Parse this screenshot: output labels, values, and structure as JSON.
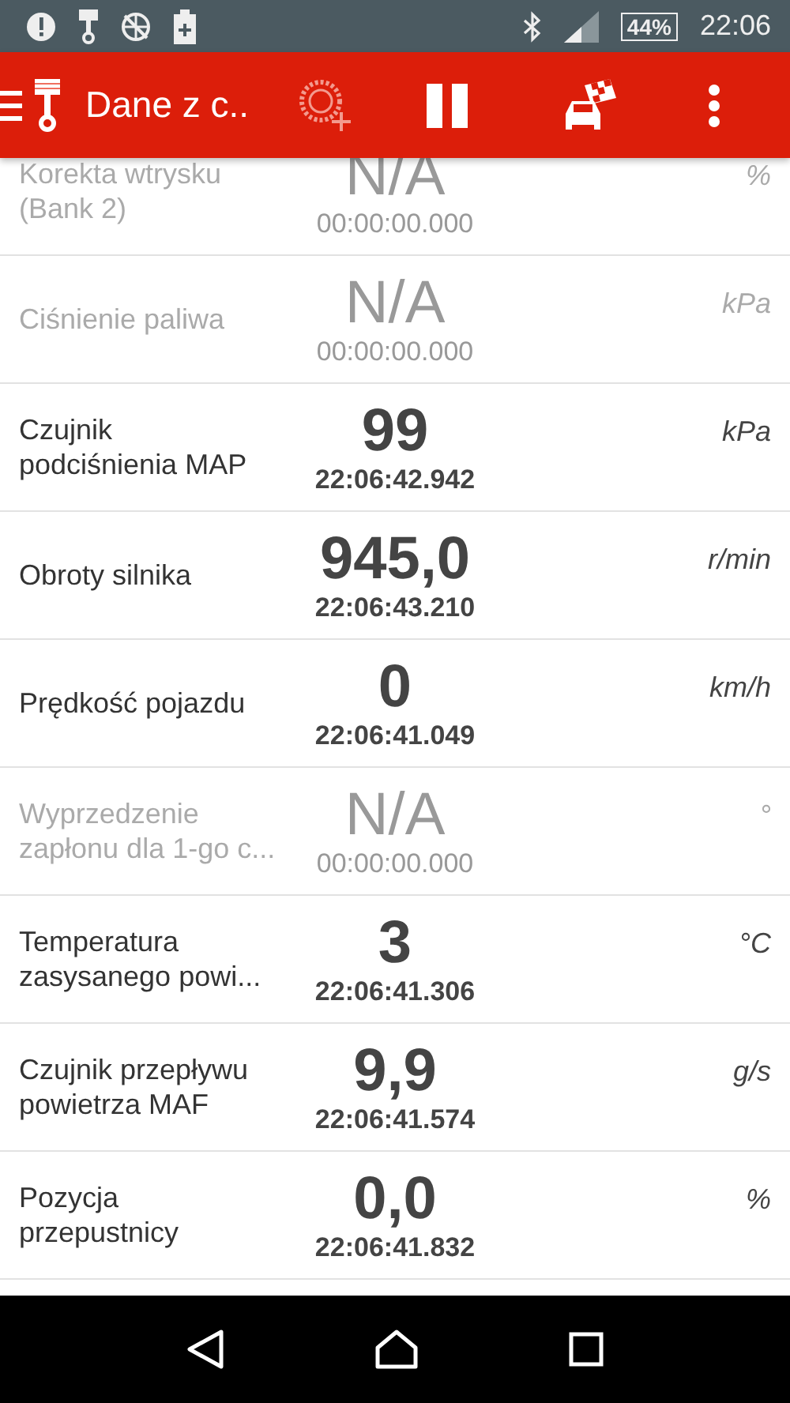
{
  "status_bar": {
    "battery": "44%",
    "time": "22:06"
  },
  "app_bar": {
    "title": "Dane z c.."
  },
  "rows": [
    {
      "label": "Korekta wtrysku (Bank 2)",
      "value": "N/A",
      "timestamp": "00:00:00.000",
      "unit": "%",
      "disabled": true
    },
    {
      "label": "Ciśnienie paliwa",
      "value": "N/A",
      "timestamp": "00:00:00.000",
      "unit": "kPa",
      "disabled": true
    },
    {
      "label": "Czujnik podciśnienia MAP",
      "value": "99",
      "timestamp": "22:06:42.942",
      "unit": "kPa",
      "disabled": false
    },
    {
      "label": "Obroty silnika",
      "value": "945,0",
      "timestamp": "22:06:43.210",
      "unit": "r/min",
      "disabled": false
    },
    {
      "label": "Prędkość pojazdu",
      "value": "0",
      "timestamp": "22:06:41.049",
      "unit": "km/h",
      "disabled": false
    },
    {
      "label": "Wyprzedzenie zapłonu dla 1-go c...",
      "value": "N/A",
      "timestamp": "00:00:00.000",
      "unit": "°",
      "disabled": true
    },
    {
      "label": "Temperatura zasysanego powi...",
      "value": "3",
      "timestamp": "22:06:41.306",
      "unit": "°C",
      "disabled": false
    },
    {
      "label": "Czujnik przepływu powietrza MAF",
      "value": "9,9",
      "timestamp": "22:06:41.574",
      "unit": "g/s",
      "disabled": false
    },
    {
      "label": "Pozycja przepustnicy",
      "value": "0,0",
      "timestamp": "22:06:41.832",
      "unit": "%",
      "disabled": false
    }
  ]
}
